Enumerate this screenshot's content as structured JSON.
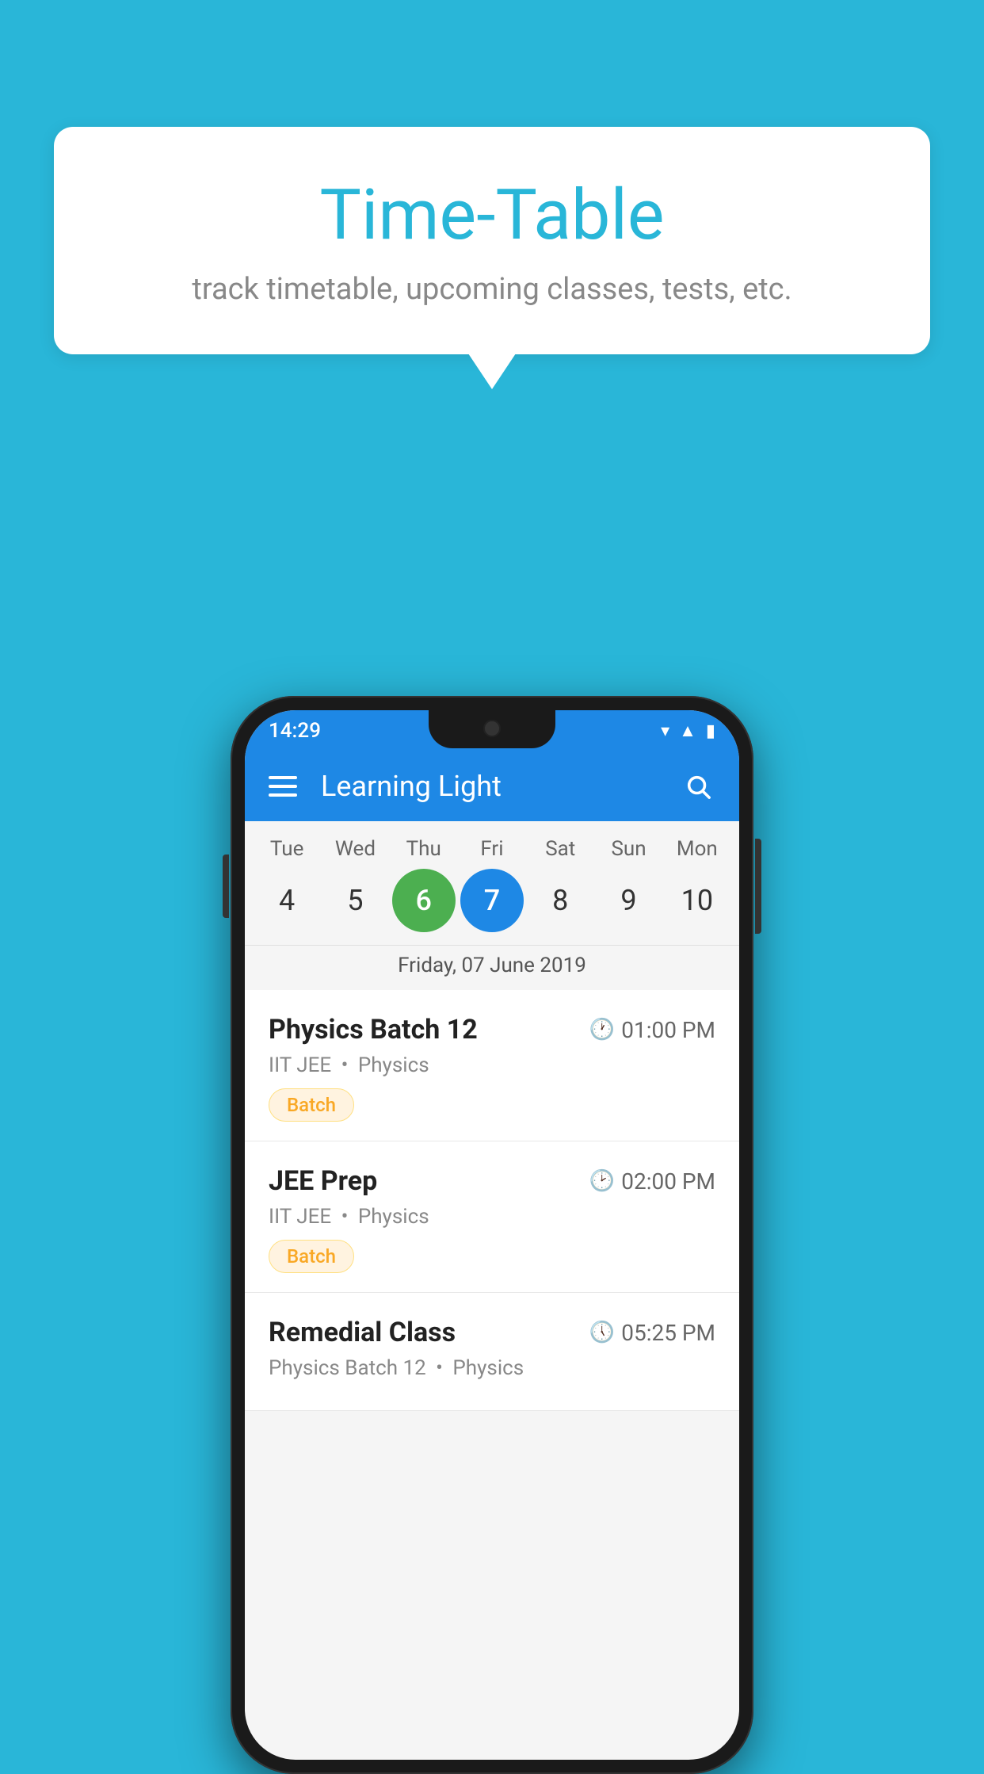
{
  "background_color": "#29B6D8",
  "speech_bubble": {
    "title": "Time-Table",
    "subtitle": "track timetable, upcoming classes, tests, etc."
  },
  "phone": {
    "status_bar": {
      "time": "14:29",
      "wifi_icon": "wifi",
      "signal_icon": "signal",
      "battery_icon": "battery"
    },
    "app_bar": {
      "title": "Learning Light",
      "menu_icon": "hamburger",
      "search_icon": "search"
    },
    "calendar": {
      "days": [
        {
          "name": "Tue",
          "number": "4"
        },
        {
          "name": "Wed",
          "number": "5"
        },
        {
          "name": "Thu",
          "number": "6",
          "state": "today"
        },
        {
          "name": "Fri",
          "number": "7",
          "state": "selected"
        },
        {
          "name": "Sat",
          "number": "8"
        },
        {
          "name": "Sun",
          "number": "9"
        },
        {
          "name": "Mon",
          "number": "10"
        }
      ],
      "selected_date_label": "Friday, 07 June 2019"
    },
    "schedule": {
      "items": [
        {
          "title": "Physics Batch 12",
          "time": "01:00 PM",
          "sub1": "IIT JEE",
          "sub2": "Physics",
          "badge": "Batch"
        },
        {
          "title": "JEE Prep",
          "time": "02:00 PM",
          "sub1": "IIT JEE",
          "sub2": "Physics",
          "badge": "Batch"
        },
        {
          "title": "Remedial Class",
          "time": "05:25 PM",
          "sub1": "Physics Batch 12",
          "sub2": "Physics",
          "badge": ""
        }
      ]
    }
  }
}
